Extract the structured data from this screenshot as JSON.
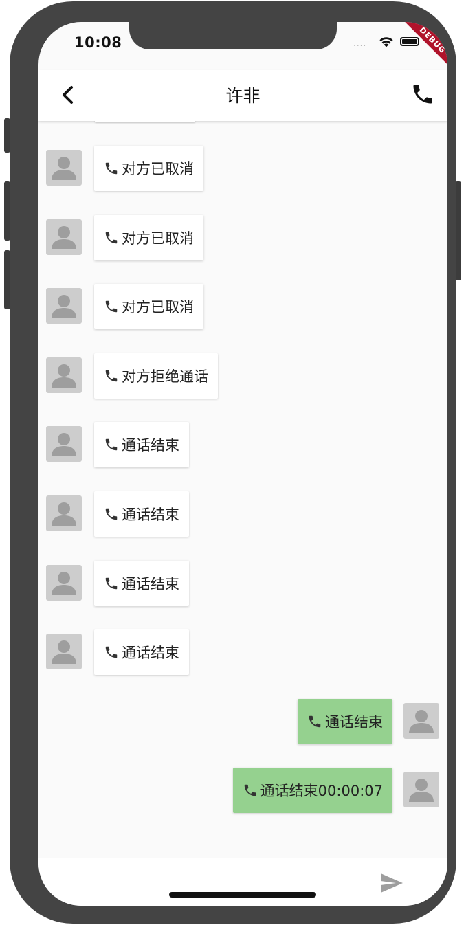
{
  "status_bar": {
    "time": "10:08",
    "signal_dots": "....",
    "debug_label": "DEBUG"
  },
  "appbar": {
    "title": "许非",
    "back_icon": "chevron-left-icon",
    "call_icon": "phone-icon"
  },
  "messages": [
    {
      "side": "left",
      "text": "对方已取消",
      "icon": "phone-icon"
    },
    {
      "side": "left",
      "text": "对方已取消",
      "icon": "phone-icon"
    },
    {
      "side": "left",
      "text": "对方已取消",
      "icon": "phone-icon"
    },
    {
      "side": "left",
      "text": "对方拒绝通话",
      "icon": "phone-icon"
    },
    {
      "side": "left",
      "text": "通话结束",
      "icon": "phone-icon"
    },
    {
      "side": "left",
      "text": "通话结束",
      "icon": "phone-icon"
    },
    {
      "side": "left",
      "text": "通话结束",
      "icon": "phone-icon"
    },
    {
      "side": "left",
      "text": "通话结束",
      "icon": "phone-icon"
    },
    {
      "side": "right",
      "text": "通话结束",
      "icon": "phone-icon"
    },
    {
      "side": "right",
      "text": "通话结束00:00:07",
      "icon": "phone-icon"
    }
  ],
  "input_bar": {
    "send_icon": "send-icon"
  },
  "colors": {
    "frame": "#444444",
    "screen_bg": "#fafafa",
    "bubble_incoming": "#ffffff",
    "bubble_outgoing": "#95d18f",
    "avatar_bg": "#cdcdcd",
    "avatar_fg": "#9e9e9e",
    "debug_ribbon": "#b0132b"
  }
}
